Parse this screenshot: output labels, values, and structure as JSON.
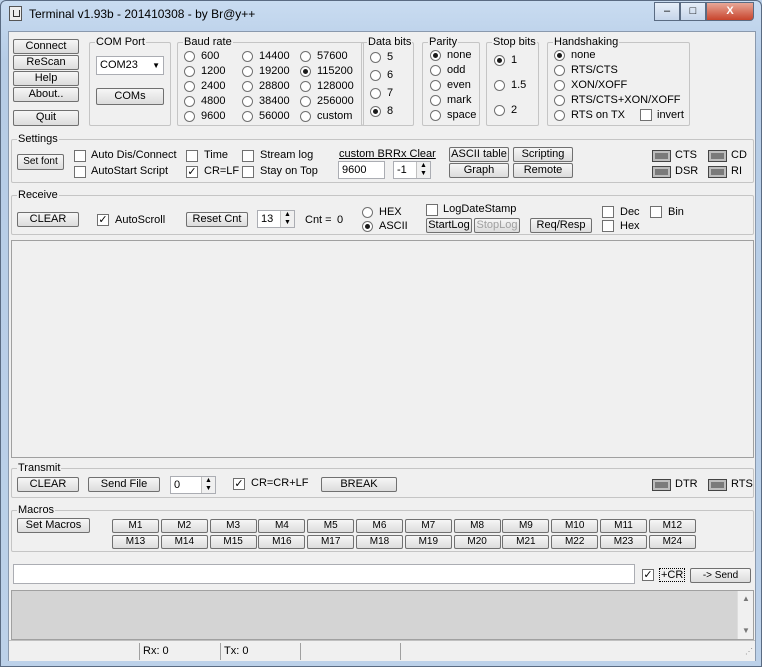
{
  "window": {
    "title": "Terminal v1.93b - 201410308 - by Br@y++",
    "min": "–",
    "max": "□",
    "close": "X"
  },
  "conn_buttons": {
    "connect": "Connect",
    "rescan": "ReScan",
    "help": "Help",
    "about": "About..",
    "quit": "Quit"
  },
  "com_port": {
    "label": "COM Port",
    "value": "COM23",
    "coms": "COMs"
  },
  "baud": {
    "label": "Baud rate",
    "options": [
      "600",
      "1200",
      "2400",
      "4800",
      "9600",
      "14400",
      "19200",
      "28800",
      "38400",
      "56000",
      "57600",
      "115200",
      "128000",
      "256000",
      "custom"
    ],
    "selected": "115200"
  },
  "databits": {
    "label": "Data bits",
    "options": [
      "5",
      "6",
      "7",
      "8"
    ],
    "selected": "8"
  },
  "parity": {
    "label": "Parity",
    "options": [
      "none",
      "odd",
      "even",
      "mark",
      "space"
    ],
    "selected": "none"
  },
  "stopbits": {
    "label": "Stop bits",
    "options": [
      "1",
      "1.5",
      "2"
    ],
    "selected": "1"
  },
  "handshaking": {
    "label": "Handshaking",
    "options": [
      "none",
      "RTS/CTS",
      "XON/XOFF",
      "RTS/CTS+XON/XOFF",
      "RTS on TX"
    ],
    "invert": "invert",
    "selected": "none"
  },
  "settings": {
    "label": "Settings",
    "set_font": "Set font",
    "auto_dis": "Auto Dis/Connect",
    "autostart": "AutoStart Script",
    "time": "Time",
    "crlf": "CR=LF",
    "stream_log": "Stream log",
    "stay_on_top": "Stay on Top",
    "custom_br_label": "custom BR",
    "custom_br": "9600",
    "rx_clear_label": "Rx Clear",
    "rx_clear": "-1",
    "ascii_table": "ASCII table",
    "scripting": "Scripting",
    "graph": "Graph",
    "remote": "Remote"
  },
  "signals": {
    "cts": "CTS",
    "cd": "CD",
    "dsr": "DSR",
    "ri": "RI",
    "dtr": "DTR",
    "rts": "RTS"
  },
  "receive": {
    "label": "Receive",
    "clear": "CLEAR",
    "autoscroll": "AutoScroll",
    "reset_cnt": "Reset Cnt",
    "cnt_value": "13",
    "cnt_label": "Cnt =",
    "cnt": "0",
    "hex": "HEX",
    "ascii": "ASCII",
    "log_date": "LogDateStamp",
    "start_log": "StartLog",
    "stop_log": "StopLog",
    "req_resp": "Req/Resp",
    "dec": "Dec",
    "bin": "Bin",
    "hexc": "Hex"
  },
  "transmit": {
    "label": "Transmit",
    "clear": "CLEAR",
    "send_file": "Send File",
    "counter": "0",
    "crcrlf": "CR=CR+LF",
    "break": "BREAK"
  },
  "macros": {
    "label": "Macros",
    "set": "Set Macros",
    "items": [
      "M1",
      "M2",
      "M3",
      "M4",
      "M5",
      "M6",
      "M7",
      "M8",
      "M9",
      "M10",
      "M11",
      "M12",
      "M13",
      "M14",
      "M15",
      "M16",
      "M17",
      "M18",
      "M19",
      "M20",
      "M21",
      "M22",
      "M23",
      "M24"
    ]
  },
  "send": {
    "input": "",
    "plus_cr": "+CR",
    "send": "-> Send"
  },
  "status": {
    "rx": "Rx: 0",
    "tx": "Tx: 0"
  }
}
